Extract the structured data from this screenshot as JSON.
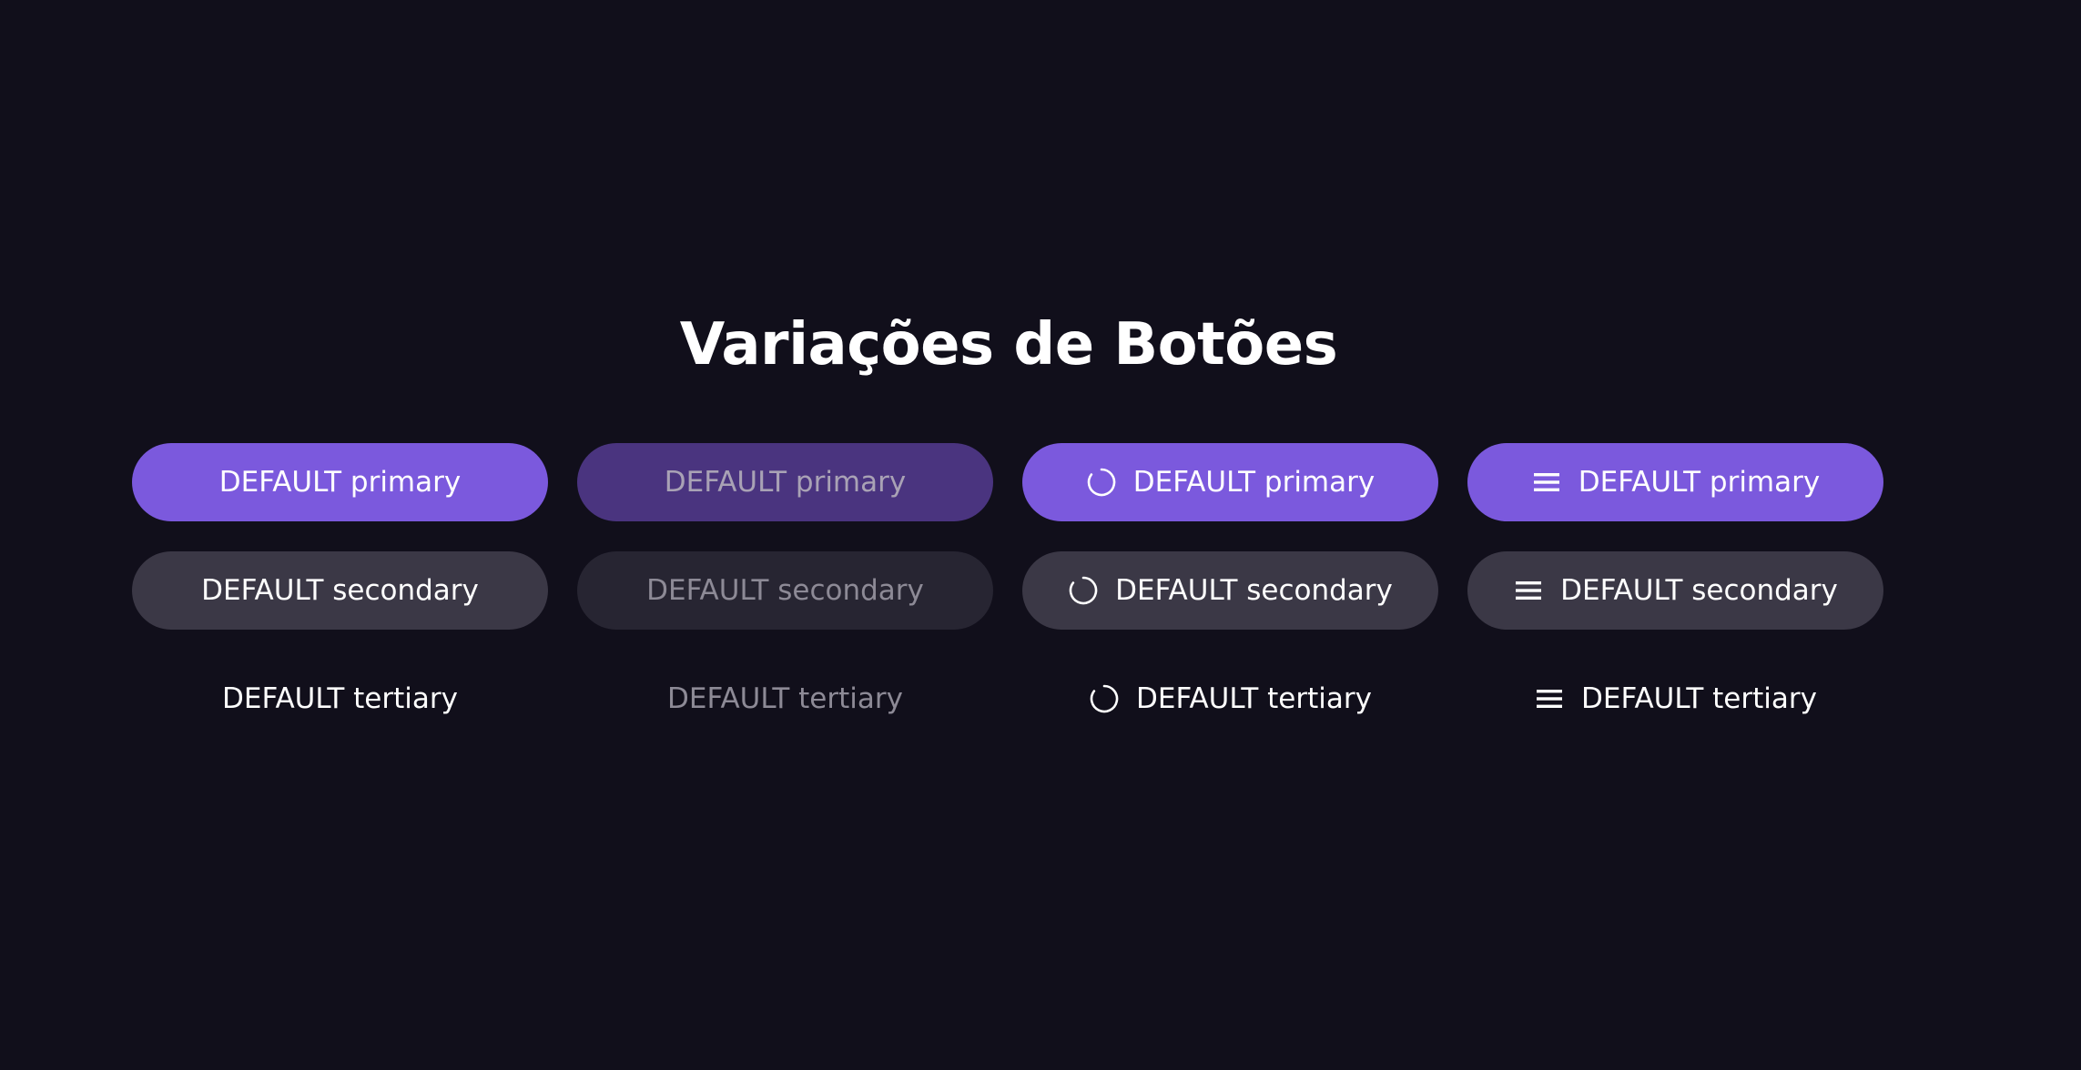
{
  "page": {
    "title": "Variações de Botões"
  },
  "colors": {
    "background": "#110f1b",
    "primary": "#7b59dd",
    "primary_disabled": "#4a347f",
    "secondary": "#3b3846",
    "secondary_disabled": "#272532",
    "text": "#ffffff",
    "text_disabled": "#8d8a96"
  },
  "rows": [
    {
      "variant": "primary",
      "buttons": [
        {
          "label": "DEFAULT primary",
          "state": "default",
          "icon": null
        },
        {
          "label": "DEFAULT primary",
          "state": "disabled",
          "icon": null
        },
        {
          "label": "DEFAULT primary",
          "state": "loading",
          "icon": "spinner-icon"
        },
        {
          "label": "DEFAULT primary",
          "state": "with-icon",
          "icon": "menu-icon"
        }
      ]
    },
    {
      "variant": "secondary",
      "buttons": [
        {
          "label": "DEFAULT secondary",
          "state": "default",
          "icon": null
        },
        {
          "label": "DEFAULT secondary",
          "state": "disabled",
          "icon": null
        },
        {
          "label": "DEFAULT secondary",
          "state": "loading",
          "icon": "spinner-icon"
        },
        {
          "label": "DEFAULT secondary",
          "state": "with-icon",
          "icon": "menu-icon"
        }
      ]
    },
    {
      "variant": "tertiary",
      "buttons": [
        {
          "label": "DEFAULT tertiary",
          "state": "default",
          "icon": null
        },
        {
          "label": "DEFAULT tertiary",
          "state": "disabled",
          "icon": null
        },
        {
          "label": "DEFAULT tertiary",
          "state": "loading",
          "icon": "spinner-icon"
        },
        {
          "label": "DEFAULT tertiary",
          "state": "with-icon",
          "icon": "menu-icon"
        }
      ]
    }
  ]
}
